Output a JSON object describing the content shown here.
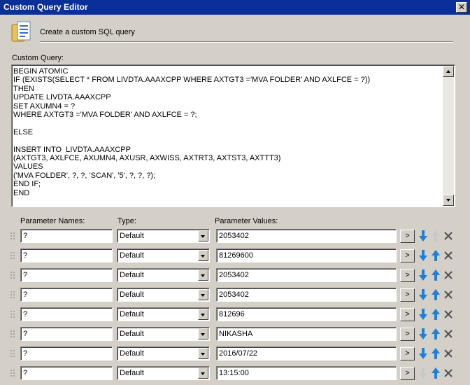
{
  "window": {
    "title": "Custom Query Editor",
    "close_glyph": "✕"
  },
  "header": {
    "text": "Create a custom SQL query",
    "icon": "database-query-icon"
  },
  "query": {
    "label": "Custom Query:",
    "text": "BEGIN ATOMIC\nIF (EXISTS(SELECT * FROM LIVDTA.AAAXCPP WHERE AXTGT3 ='MVA FOLDER' AND AXLFCE = ?))\nTHEN\nUPDATE LIVDTA.AAAXCPP\nSET AXUMN4 = ?\nWHERE AXTGT3 ='MVA FOLDER' AND AXLFCE = ?;\n\nELSE\n\nINSERT INTO  LIVDTA.AAAXCPP\n(AXTGT3, AXLFCE, AXUMN4, AXUSR, AXWISS, AXTRT3, AXTST3, AXTTT3)\nVALUES\n('MVA FOLDER', ?, ?, 'SCAN', '5', ?, ?, ?);\nEND IF;\nEND"
  },
  "columns": {
    "names": "Parameter Names:",
    "type": "Type:",
    "values": "Parameter Values:"
  },
  "colors": {
    "titlebar": "#0b2f99",
    "arrow_blue": "#1e7fd8",
    "arrow_disabled": "#c8c8c8",
    "delete_gray": "#505050"
  },
  "parameters": [
    {
      "name": "?",
      "type": "Default",
      "value": "2053402",
      "pick": ">",
      "up_enabled": false,
      "down_enabled": true
    },
    {
      "name": "?",
      "type": "Default",
      "value": "81269600",
      "pick": ">",
      "up_enabled": true,
      "down_enabled": true
    },
    {
      "name": "?",
      "type": "Default",
      "value": "2053402",
      "pick": ">",
      "up_enabled": true,
      "down_enabled": true
    },
    {
      "name": "?",
      "type": "Default",
      "value": "2053402",
      "pick": ">",
      "up_enabled": true,
      "down_enabled": true
    },
    {
      "name": "?",
      "type": "Default",
      "value": "812696",
      "pick": ">",
      "up_enabled": true,
      "down_enabled": true
    },
    {
      "name": "?",
      "type": "Default",
      "value": "NIKASHA",
      "pick": ">",
      "up_enabled": true,
      "down_enabled": true
    },
    {
      "name": "?",
      "type": "Default",
      "value": "2016/07/22",
      "pick": ">",
      "up_enabled": true,
      "down_enabled": true
    },
    {
      "name": "?",
      "type": "Default",
      "value": "13:15:00",
      "pick": ">",
      "up_enabled": true,
      "down_enabled": false
    }
  ]
}
